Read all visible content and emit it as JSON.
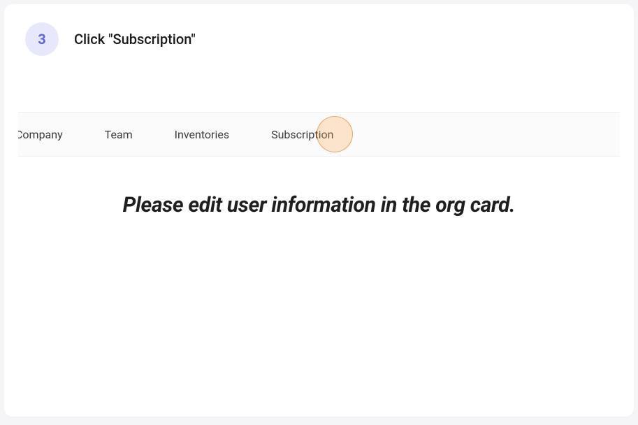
{
  "step": {
    "number": "3",
    "title": "Click \"Subscription\""
  },
  "tabs": {
    "company": "Company",
    "team": "Team",
    "inventories": "Inventories",
    "subscription": "Subscription"
  },
  "message": "Please edit user information in the org card."
}
